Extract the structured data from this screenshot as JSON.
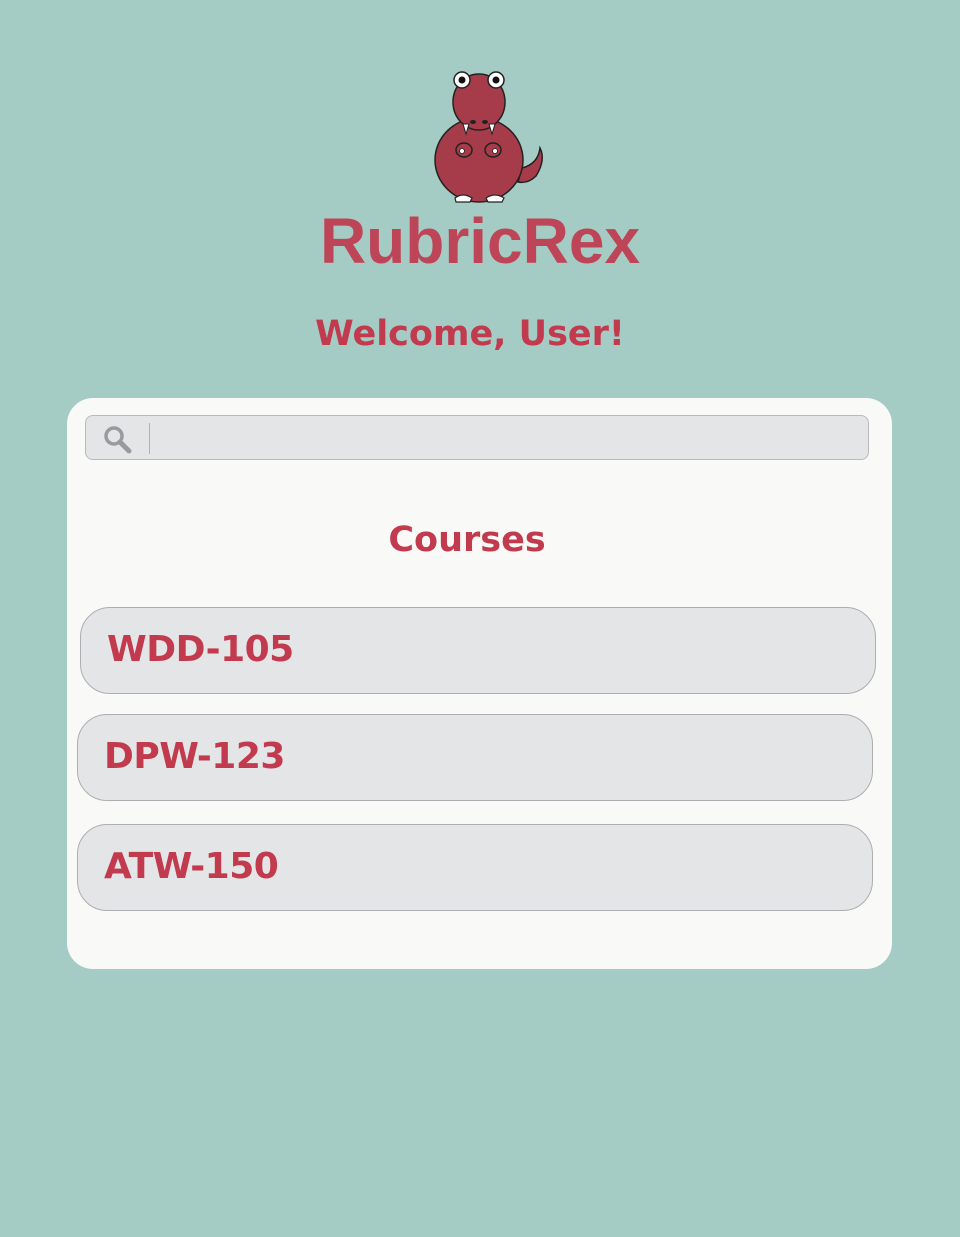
{
  "app": {
    "logo_text": "RubricRex"
  },
  "header": {
    "welcome": "Welcome, User!"
  },
  "search": {
    "value": "",
    "placeholder": ""
  },
  "courses": {
    "title": "Courses",
    "items": [
      {
        "label": "WDD-105"
      },
      {
        "label": "DPW-123"
      },
      {
        "label": "ATW-150"
      }
    ]
  },
  "colors": {
    "background": "#a4cbc4",
    "accent": "#c13a4e",
    "card": "#f9f9f7",
    "field": "#e4e5e7"
  },
  "icons": {
    "logo": "dinosaur-icon",
    "search": "search-icon"
  }
}
